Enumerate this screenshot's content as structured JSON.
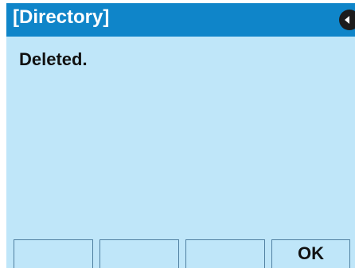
{
  "titlebar": {
    "title": "[Directory]",
    "back_icon": "back-arrow-icon"
  },
  "main": {
    "message": "Deleted."
  },
  "softkeys": [
    {
      "label": ""
    },
    {
      "label": ""
    },
    {
      "label": ""
    },
    {
      "label": "OK"
    }
  ],
  "colors": {
    "titlebar": "#0f85c9",
    "screen_background": "#bfe6f9",
    "softkey_border": "#4f7fa0"
  }
}
